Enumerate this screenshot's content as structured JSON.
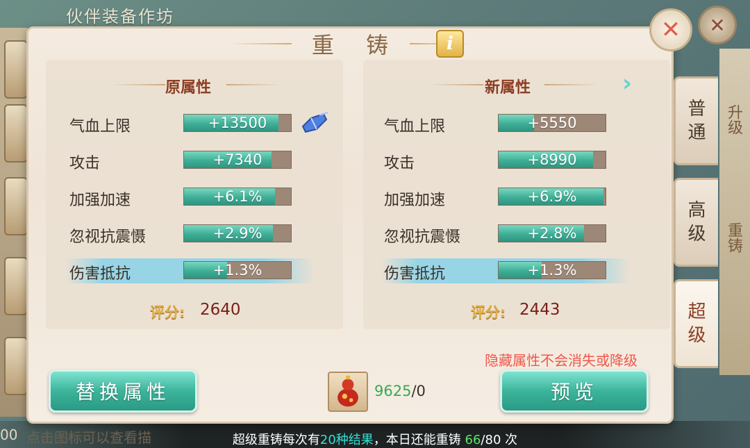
{
  "background": {
    "title": "伙伴装备作坊",
    "right_tab_upgrade": "升级",
    "right_tab_recast": "重铸",
    "bottom_left_number": "00",
    "bottom_hint": "点击图标可以查看描"
  },
  "dialog": {
    "title": "重 铸",
    "info_label": "i",
    "close_label": "✕"
  },
  "original": {
    "heading": "原属性",
    "rows": [
      {
        "label": "气血上限",
        "value": "+13500",
        "fill": 0.88
      },
      {
        "label": "攻击",
        "value": "+7340",
        "fill": 0.82
      },
      {
        "label": "加强加速",
        "value": "+6.1%",
        "fill": 0.85
      },
      {
        "label": "忽视抗震慑",
        "value": "+2.9%",
        "fill": 0.83
      },
      {
        "label": "伤害抵抗",
        "value": "+1.3%",
        "fill": 0.4
      }
    ],
    "score_label": "评分:",
    "score": "2640"
  },
  "new": {
    "heading": "新属性",
    "rows": [
      {
        "label": "气血上限",
        "value": "+5550",
        "fill": 0.33
      },
      {
        "label": "攻击",
        "value": "+8990",
        "fill": 0.88
      },
      {
        "label": "加强加速",
        "value": "+6.9%",
        "fill": 0.98
      },
      {
        "label": "忽视抗震慑",
        "value": "+2.8%",
        "fill": 0.8
      },
      {
        "label": "伤害抵抗",
        "value": "+1.3%",
        "fill": 0.4
      }
    ],
    "score_label": "评分:",
    "score": "2443"
  },
  "warning": "隐藏属性不会消失或降级",
  "buttons": {
    "replace": "替换属性",
    "preview": "预览"
  },
  "item": {
    "have": "9625",
    "need": "/0"
  },
  "tabs": [
    {
      "label": "普\n通",
      "active": false
    },
    {
      "label": "高\n级",
      "active": false
    },
    {
      "label": "超\n级",
      "active": true
    }
  ],
  "footer": {
    "part1": "超级重铸每次有",
    "highlight1": "20种结果",
    "part2": "，本日还能重铸 ",
    "highlight2": "66",
    "part3": "/80 次"
  },
  "colors": {
    "accent_teal": "#3cb49b",
    "score_red": "#7a1f18",
    "warning_red": "#f0574a"
  }
}
